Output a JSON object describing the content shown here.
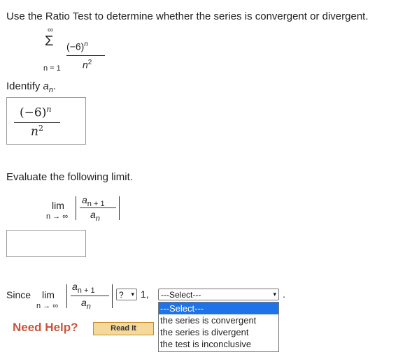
{
  "question": "Use the Ratio Test to determine whether the series is convergent or divergent.",
  "series": {
    "sum_symbol": "Σ",
    "upper": "∞",
    "lower": "n = 1",
    "numerator": "(−6)",
    "numerator_exp": "n",
    "denominator": "n",
    "denominator_exp": "2"
  },
  "identify": {
    "label_prefix": "Identify ",
    "label_var": "a",
    "label_sub": "n",
    "label_suffix": ".",
    "answer_numerator": "(−6)",
    "answer_numerator_exp": "n",
    "answer_denominator": "n",
    "answer_denominator_exp": "2"
  },
  "evaluate": {
    "label": "Evaluate the following limit.",
    "lim": "lim",
    "lim_sub": "n → ∞",
    "num_var": "a",
    "num_sub": "n + 1",
    "den_var": "a",
    "den_sub": "n",
    "input_value": ""
  },
  "since": {
    "prefix": "Since",
    "lim": "lim",
    "lim_sub": "n → ∞",
    "num_var": "a",
    "num_sub": "n + 1",
    "den_var": "a",
    "den_sub": "n",
    "comparison_value": "?",
    "one_text": "1,",
    "conclusion_value": "---Select---",
    "period": "."
  },
  "conclusion_options": [
    "---Select---",
    "the series is convergent",
    "the series is divergent",
    "the test is inconclusive"
  ],
  "help": {
    "need_help": "Need Help?",
    "read_it": "Read It"
  }
}
